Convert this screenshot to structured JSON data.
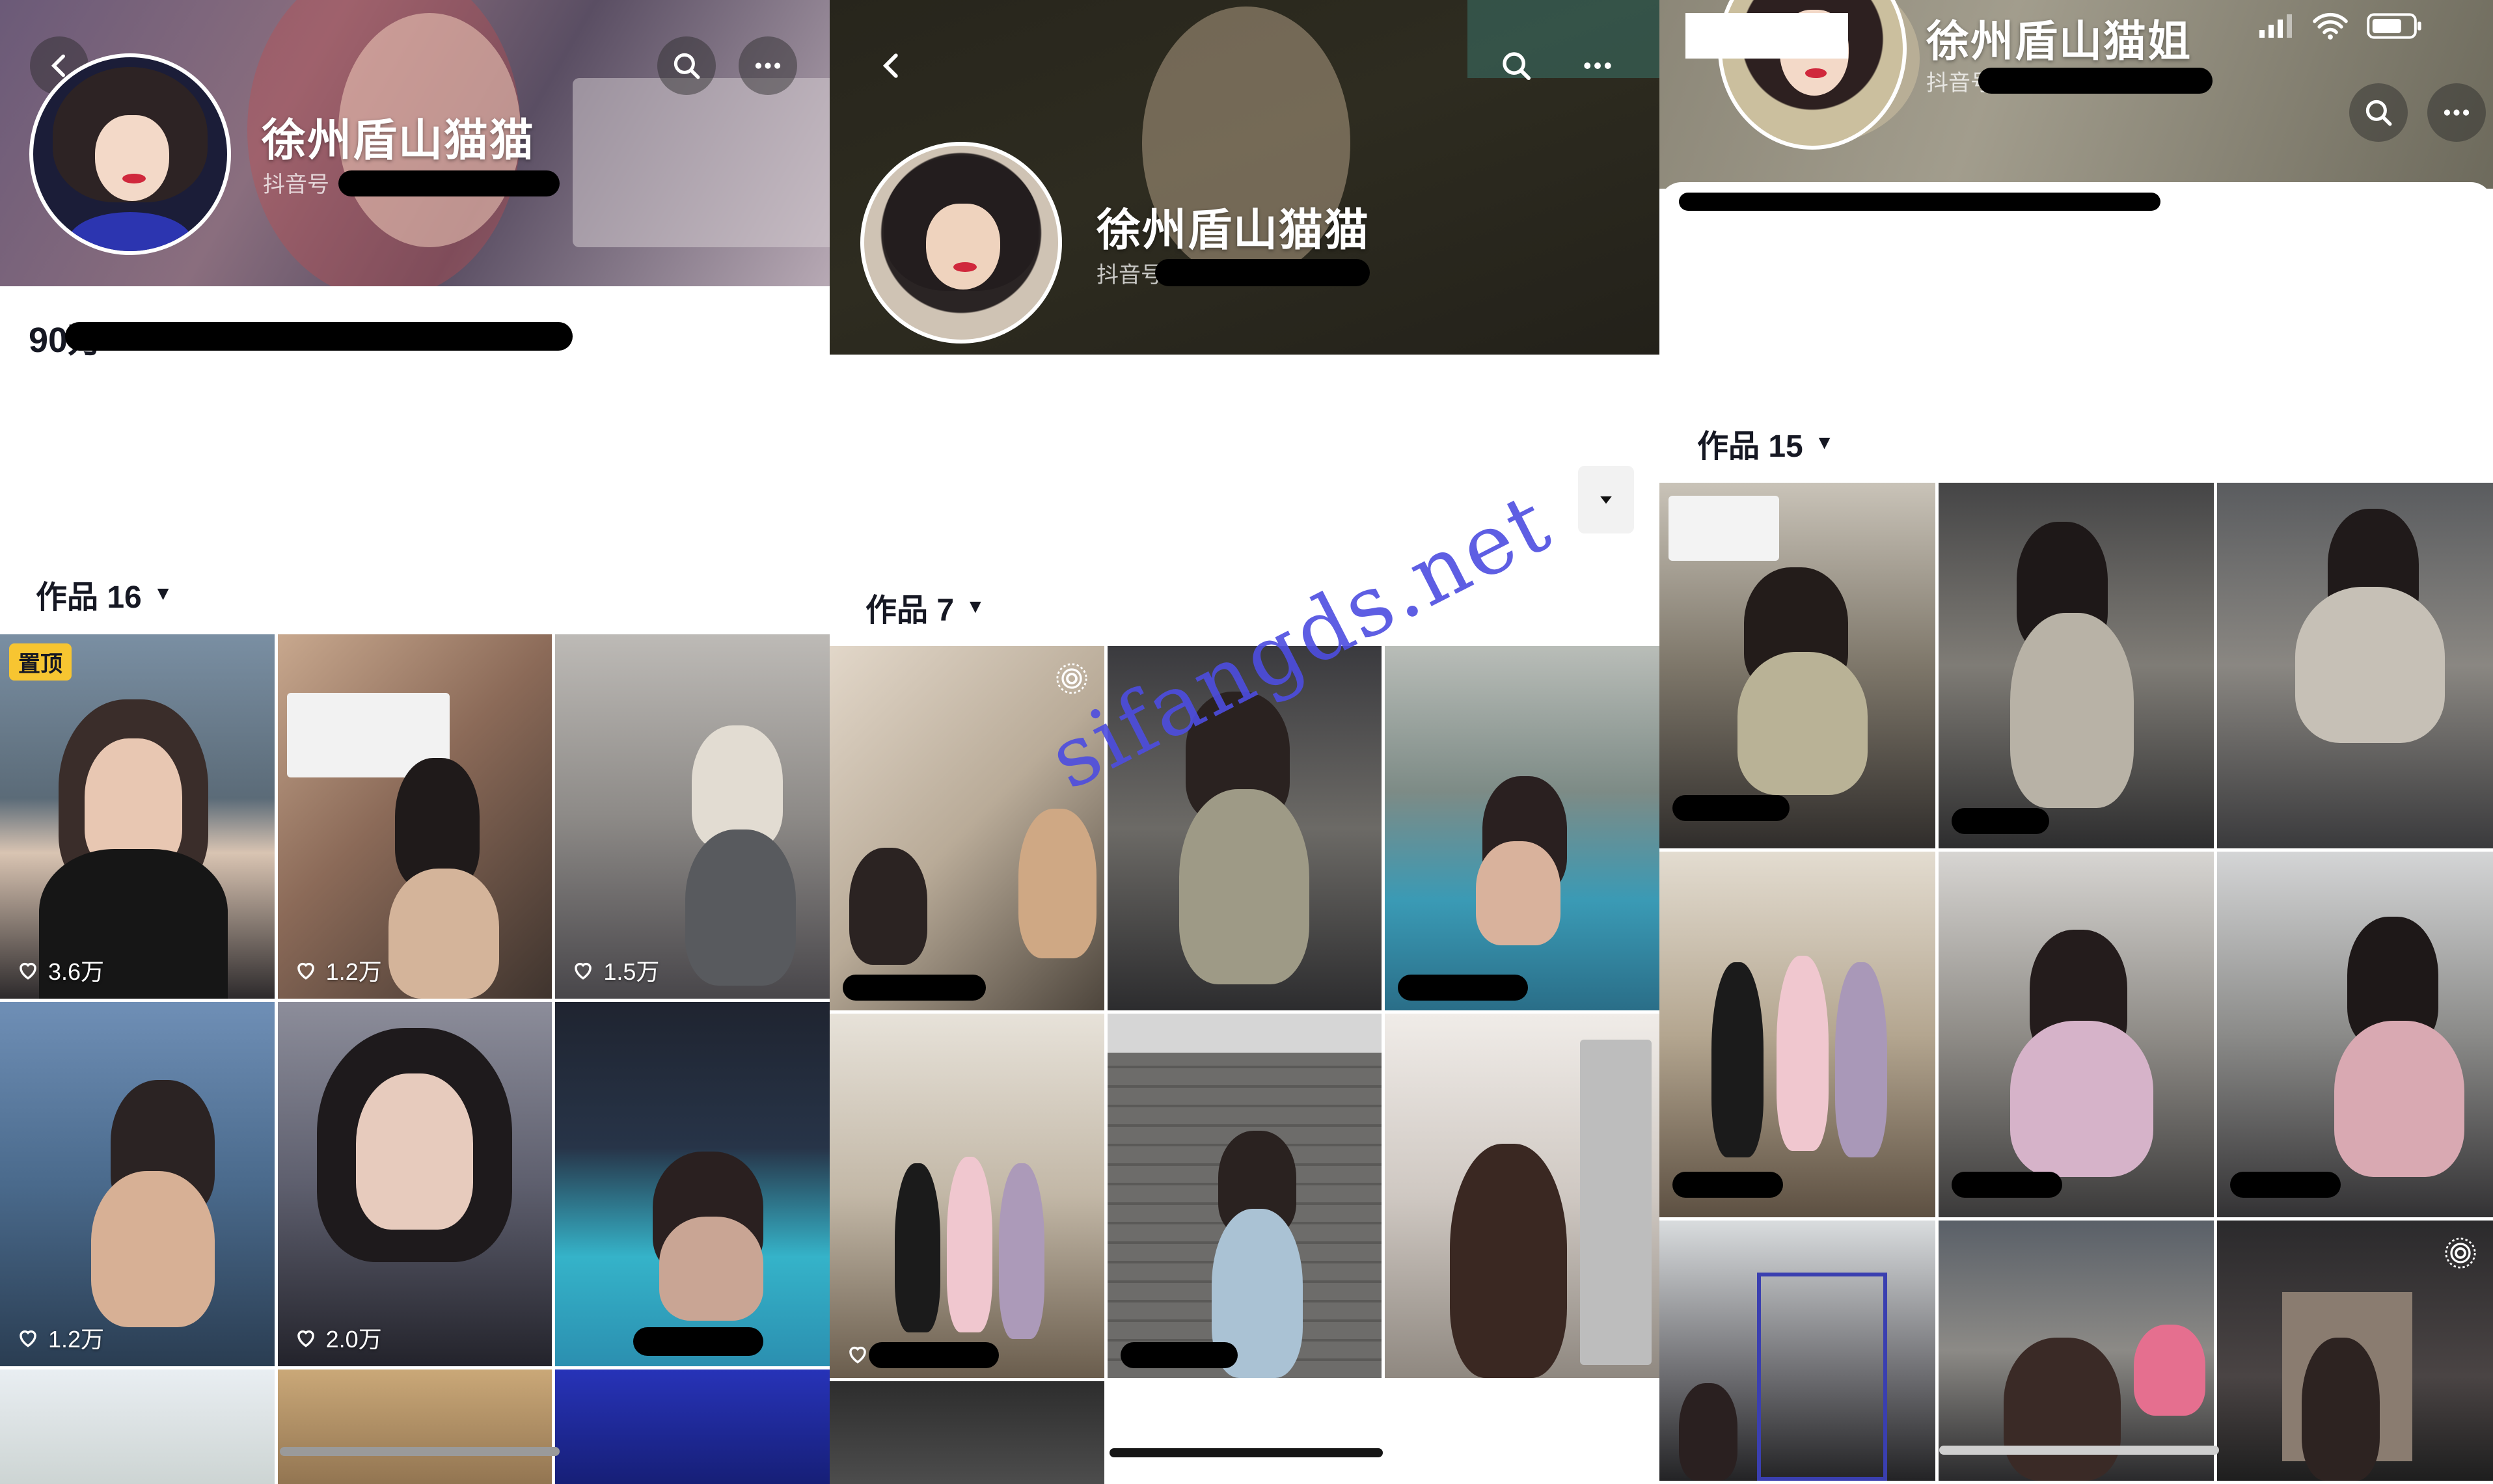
{
  "panels": [
    {
      "name": "徐州盾山猫猫",
      "douyin_id_prefix": "抖音号",
      "stats_prefix": "90",
      "stats_unit": "万",
      "works_label": "作品 16",
      "videos": [
        {
          "pinned_label": "置顶",
          "likes": "3.6万"
        },
        {
          "likes": "1.2万"
        },
        {
          "likes": "1.5万"
        },
        {
          "likes": "1.2万"
        },
        {
          "likes": "2.0万"
        },
        {
          "likes": ""
        },
        {
          "likes": ""
        },
        {
          "likes": ""
        },
        {
          "likes": ""
        }
      ]
    },
    {
      "name": "徐州盾山猫猫",
      "douyin_id_prefix": "抖音号",
      "works_label": "作品 7"
    },
    {
      "name": "徐州盾山猫姐",
      "douyin_id_prefix": "抖音号",
      "works_label": "作品 15"
    }
  ],
  "watermark": "sifangds.net",
  "icons": {
    "back": "chevron-left-icon",
    "search": "search-icon",
    "more": "more-icon",
    "heart": "heart-icon",
    "live": "live-photo-icon",
    "caret": "caret-down-icon",
    "signal": "signal-icon",
    "wifi": "wifi-icon",
    "battery": "battery-icon"
  }
}
